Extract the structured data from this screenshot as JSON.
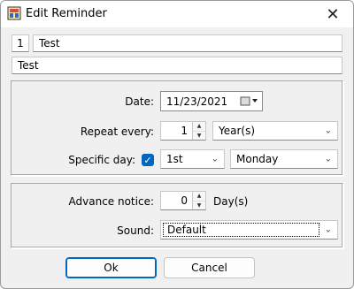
{
  "window": {
    "title": "Edit Reminder",
    "close_symbol": "✕"
  },
  "top": {
    "number": "1",
    "name": "Test",
    "description": "Test"
  },
  "date": {
    "label": "Date:",
    "value": "11/23/2021"
  },
  "repeat": {
    "label": "Repeat every:",
    "value": "1",
    "unit": "Year(s)"
  },
  "specific_day": {
    "label": "Specific day:",
    "checked": true,
    "ordinal": "1st",
    "weekday": "Monday"
  },
  "advance": {
    "label": "Advance notice:",
    "value": "0",
    "unit": "Day(s)"
  },
  "sound": {
    "label": "Sound:",
    "value": "Default"
  },
  "buttons": {
    "ok": "Ok",
    "cancel": "Cancel"
  },
  "colors": {
    "accent": "#0067c0"
  }
}
